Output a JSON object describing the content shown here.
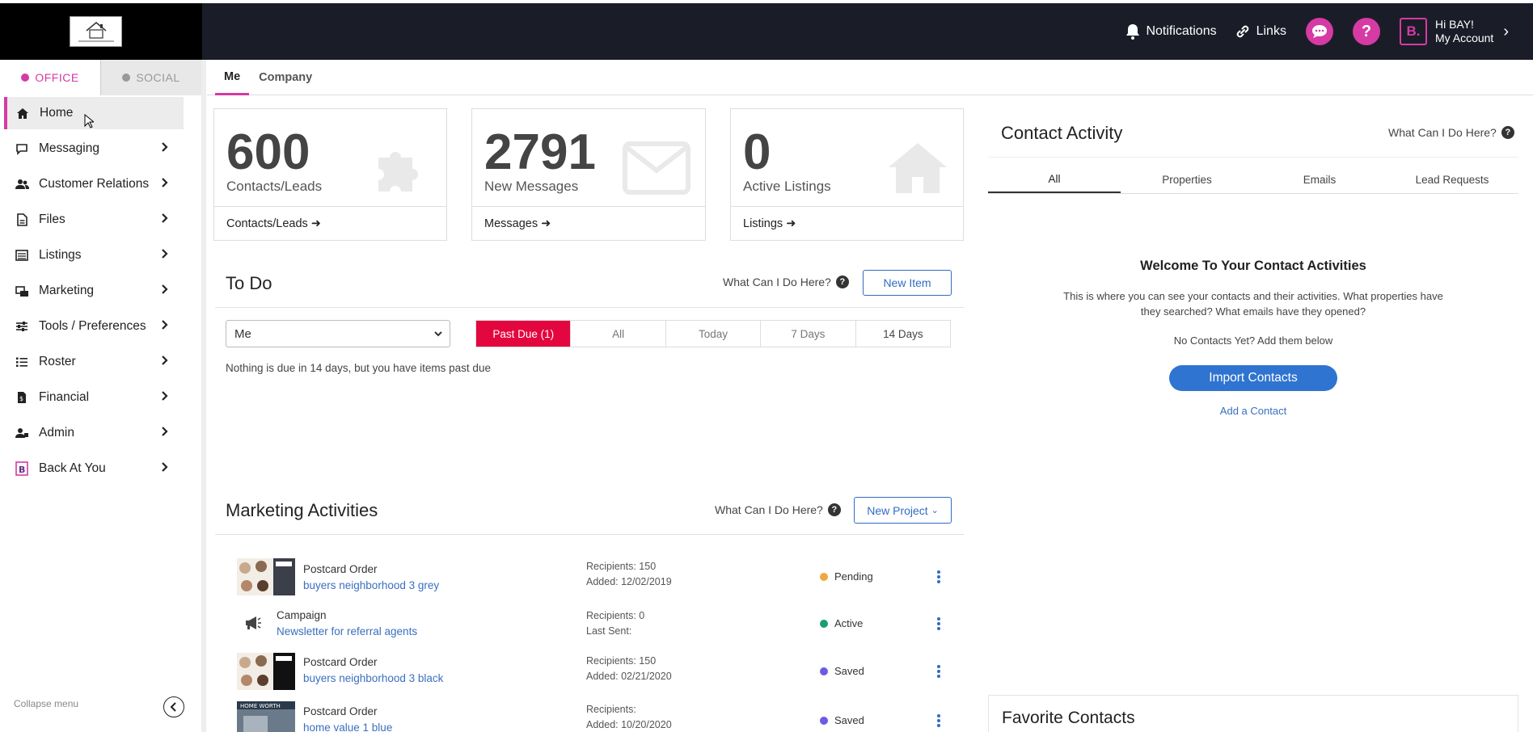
{
  "header": {
    "logo_text": "REAL ESTATE COMPANY",
    "notifications_label": "Notifications",
    "links_label": "Links",
    "greeting": "Hi BAY!",
    "account_label": "My Account",
    "account_badge": "B."
  },
  "sidebar": {
    "tabs": [
      {
        "label": "OFFICE",
        "color": "#d63aa3",
        "active": true
      },
      {
        "label": "SOCIAL",
        "color": "#999999",
        "active": false
      }
    ],
    "items": [
      {
        "label": "Home",
        "icon": "home-icon"
      },
      {
        "label": "Messaging",
        "icon": "chat-bubble-icon"
      },
      {
        "label": "Customer Relations",
        "icon": "people-icon"
      },
      {
        "label": "Files",
        "icon": "file-icon"
      },
      {
        "label": "Listings",
        "icon": "list-icon"
      },
      {
        "label": "Marketing",
        "icon": "marketing-icon"
      },
      {
        "label": "Tools / Preferences",
        "icon": "sliders-icon"
      },
      {
        "label": "Roster",
        "icon": "roster-icon"
      },
      {
        "label": "Financial",
        "icon": "invoice-icon"
      },
      {
        "label": "Admin",
        "icon": "admin-icon"
      },
      {
        "label": "Back At You",
        "icon": "back-at-you-icon"
      }
    ],
    "collapse_label": "Collapse menu"
  },
  "subtabs": [
    "Me",
    "Company"
  ],
  "stats": [
    {
      "value": "600",
      "label": "Contacts/Leads",
      "link": "Contacts/Leads",
      "icon": "puzzle-icon"
    },
    {
      "value": "2791",
      "label": "New Messages",
      "link": "Messages",
      "icon": "envelope-icon"
    },
    {
      "value": "0",
      "label": "Active Listings",
      "link": "Listings",
      "icon": "house-icon"
    }
  ],
  "todo": {
    "title": "To Do",
    "help": "What Can I Do Here?",
    "new_item": "New Item",
    "assignee": "Me",
    "filters": [
      "Past Due (1)",
      "All",
      "Today",
      "7 Days",
      "14 Days"
    ],
    "note": "Nothing is due in 14 days, but you have items past due"
  },
  "marketing": {
    "title": "Marketing Activities",
    "help": "What Can I Do Here?",
    "new_project": "New Project",
    "rows": [
      {
        "type": "Postcard Order",
        "name": "buyers neighborhood 3 grey",
        "meta1": "Recipients: 150",
        "meta2": "Added: 12/02/2019",
        "status": "Pending",
        "status_color": "#f0a73c"
      },
      {
        "type": "Campaign",
        "name": "Newsletter for referral agents",
        "meta1": "Recipients: 0",
        "meta2": "Last Sent:",
        "status": "Active",
        "status_color": "#1a9e6e"
      },
      {
        "type": "Postcard Order",
        "name": "buyers neighborhood 3 black",
        "meta1": "Recipients: 150",
        "meta2": "Added: 02/21/2020",
        "status": "Saved",
        "status_color": "#6b5ce7"
      },
      {
        "type": "Postcard Order",
        "name": "home value 1 blue",
        "meta1": "Recipients:",
        "meta2": "Added: 10/20/2020",
        "status": "Saved",
        "status_color": "#6b5ce7"
      }
    ]
  },
  "contact_activity": {
    "title": "Contact Activity",
    "help": "What Can I Do Here?",
    "tabs": [
      "All",
      "Properties",
      "Emails",
      "Lead Requests"
    ],
    "welcome_title": "Welcome To Your Contact Activities",
    "welcome_text_1": "This is where you can see your contacts and their activities. What properties have",
    "welcome_text_2": "they searched? What emails have they opened?",
    "no_contacts": "No Contacts Yet? Add them below",
    "import_label": "Import Contacts",
    "add_contact": "Add a Contact"
  },
  "favorites": {
    "title": "Favorite Contacts"
  },
  "colors": {
    "accent": "#d63aa3",
    "danger": "#e4073f",
    "link": "#2f6cc4",
    "topbar": "#1a1d28"
  }
}
